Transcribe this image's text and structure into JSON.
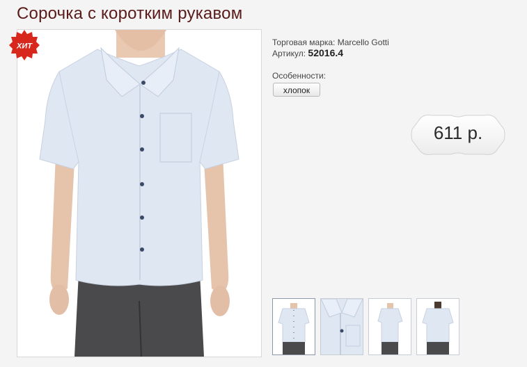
{
  "product": {
    "title": "Сорочка с коротким рукавом",
    "badge": "ХИТ",
    "brand_label": "Торговая марка:",
    "brand_value": "Marcello Gotti",
    "sku_label": "Артикул:",
    "sku_value": "52016.4",
    "features_label": "Особенности:",
    "feature_tag": "хлопок",
    "price": "611 р."
  },
  "colors": {
    "title": "#5a1a1a",
    "badge": "#d8281e",
    "shirt": "#dfe7f3"
  },
  "thumbnails": [
    {
      "name": "front"
    },
    {
      "name": "detail-pocket"
    },
    {
      "name": "side"
    },
    {
      "name": "back"
    }
  ]
}
